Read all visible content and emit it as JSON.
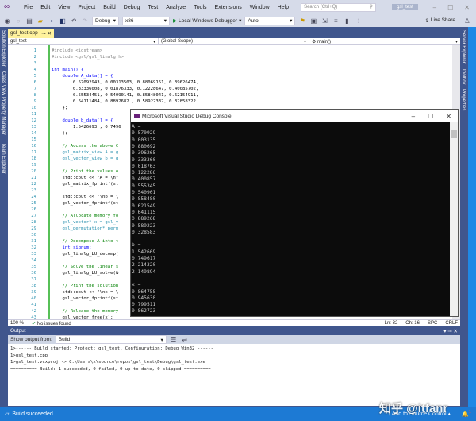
{
  "window": {
    "title": "gsl_test",
    "search_placeholder": "Search (Ctrl+Q)"
  },
  "menu": [
    "File",
    "Edit",
    "View",
    "Project",
    "Build",
    "Debug",
    "Test",
    "Analyze",
    "Tools",
    "Extensions",
    "Window",
    "Help"
  ],
  "toolbar": {
    "config": "Debug",
    "platform": "x86",
    "debugger": "Local Windows Debugger",
    "target": "Auto",
    "live_share": "Live Share"
  },
  "left_tabs": [
    "Solution Explorer",
    "Class View",
    "Property Manager",
    "Team Explorer"
  ],
  "right_tabs": [
    "Server Explorer",
    "Toolbox",
    "Properties"
  ],
  "doc_tab": {
    "label": "gsl_test.cpp"
  },
  "navbar": {
    "project": "gsl_test",
    "scope": "(Global Scope)",
    "member": "main()"
  },
  "code": [
    {
      "n": "1",
      "t": "#include <iostream>",
      "k": "pp"
    },
    {
      "n": "2",
      "t": "#include <gsl/gsl_linalg.h>",
      "k": "pp"
    },
    {
      "n": "3",
      "t": "",
      "k": "tx"
    },
    {
      "n": "4",
      "t": "int main() {",
      "k": "kw"
    },
    {
      "n": "5",
      "t": "    double A_data[] = {",
      "k": "kw"
    },
    {
      "n": "6",
      "t": "        0.57092943, 0.00313503, 0.88069151, 0.39626474,",
      "k": "tx"
    },
    {
      "n": "7",
      "t": "        0.33336008, 0.01876333, 0.12228647, 0.40085702,",
      "k": "tx"
    },
    {
      "n": "8",
      "t": "        0.55534451, 0.54090141, 0.85848041, 0.62154911,",
      "k": "tx"
    },
    {
      "n": "9",
      "t": "        0.64111484, 0.8892682 , 0.58922332, 0.32858322",
      "k": "tx"
    },
    {
      "n": "10",
      "t": "    };",
      "k": "tx"
    },
    {
      "n": "11",
      "t": "",
      "k": "tx"
    },
    {
      "n": "12",
      "t": "    double b_data[] = {",
      "k": "kw"
    },
    {
      "n": "13",
      "t": "        1.5426693 , 0.7496",
      "k": "tx"
    },
    {
      "n": "14",
      "t": "    };",
      "k": "tx"
    },
    {
      "n": "15",
      "t": "",
      "k": "tx"
    },
    {
      "n": "16",
      "t": "    // Access the above C",
      "k": "cm"
    },
    {
      "n": "17",
      "t": "    gsl_matrix_view A = g",
      "k": "ty"
    },
    {
      "n": "18",
      "t": "    gsl_vector_view b = g",
      "k": "ty"
    },
    {
      "n": "19",
      "t": "",
      "k": "tx"
    },
    {
      "n": "20",
      "t": "    // Print the values o",
      "k": "cm"
    },
    {
      "n": "21",
      "t": "    std::cout << \"A = \\n\"",
      "k": "tx"
    },
    {
      "n": "22",
      "t": "    gsl_matrix_fprintf(st",
      "k": "tx"
    },
    {
      "n": "23",
      "t": "",
      "k": "tx"
    },
    {
      "n": "24",
      "t": "    std::cout << \"\\nb = \\",
      "k": "tx"
    },
    {
      "n": "25",
      "t": "    gsl_vector_fprintf(st",
      "k": "tx"
    },
    {
      "n": "26",
      "t": "",
      "k": "tx"
    },
    {
      "n": "27",
      "t": "    // Allocate memory fo",
      "k": "cm"
    },
    {
      "n": "28",
      "t": "    gsl_vector* x = gsl_v",
      "k": "ty"
    },
    {
      "n": "29",
      "t": "    gsl_permutation* perm",
      "k": "ty"
    },
    {
      "n": "30",
      "t": "",
      "k": "tx"
    },
    {
      "n": "31",
      "t": "    // Decompose A into t",
      "k": "cm"
    },
    {
      "n": "32",
      "t": "    int signum;",
      "k": "kw"
    },
    {
      "n": "33",
      "t": "    gsl_linalg_LU_decomp(",
      "k": "tx"
    },
    {
      "n": "34",
      "t": "",
      "k": "tx"
    },
    {
      "n": "35",
      "t": "    // Solve the linear s",
      "k": "cm"
    },
    {
      "n": "36",
      "t": "    gsl_linalg_LU_solve(&",
      "k": "tx"
    },
    {
      "n": "37",
      "t": "",
      "k": "tx"
    },
    {
      "n": "38",
      "t": "    // Print the solution",
      "k": "cm"
    },
    {
      "n": "39",
      "t": "    std::cout << \"\\nx = \\",
      "k": "tx"
    },
    {
      "n": "40",
      "t": "    gsl_vector_fprintf(st",
      "k": "tx"
    },
    {
      "n": "41",
      "t": "",
      "k": "tx"
    },
    {
      "n": "42",
      "t": "    // Release the memory",
      "k": "cm"
    },
    {
      "n": "43",
      "t": "    gsl_vector_free(x);",
      "k": "tx"
    }
  ],
  "editor_status": {
    "zoom": "100 %",
    "issues": "No issues found",
    "line": "Ln: 32",
    "col": "Ch: 16",
    "spc": "SPC",
    "eol": "CRLF"
  },
  "console": {
    "title": "Microsoft Visual Studio Debug Console",
    "lines": [
      "A =",
      "0.570929",
      "0.003135",
      "0.880692",
      "0.396265",
      "0.333360",
      "0.018763",
      "0.122286",
      "0.400857",
      "0.555345",
      "0.540901",
      "0.858480",
      "0.621549",
      "0.641115",
      "0.889268",
      "0.589223",
      "0.328583",
      "",
      "b =",
      "1.542669",
      "0.749617",
      "2.214320",
      "2.149894",
      "",
      "x =",
      "0.864758",
      "0.945630",
      "0.799511",
      "0.862723"
    ]
  },
  "output": {
    "title": "Output",
    "show_from_label": "Show output from:",
    "source": "Build",
    "lines": [
      "1>------ Build started: Project: gsl_test, Configuration: Debug Win32 ------",
      "1>gsl_test.cpp",
      "1>gsl_test.vcxproj -> C:\\Users\\x\\source\\repos\\gsl_test\\Debug\\gsl_test.exe",
      "========== Build: 1 succeeded, 0 failed, 0 up-to-date, 0 skipped =========="
    ]
  },
  "statusbar": {
    "message": "Build succeeded",
    "source_control": "Add to Source Control",
    "notifications": "1"
  },
  "watermark": "知乎 @itfanr"
}
